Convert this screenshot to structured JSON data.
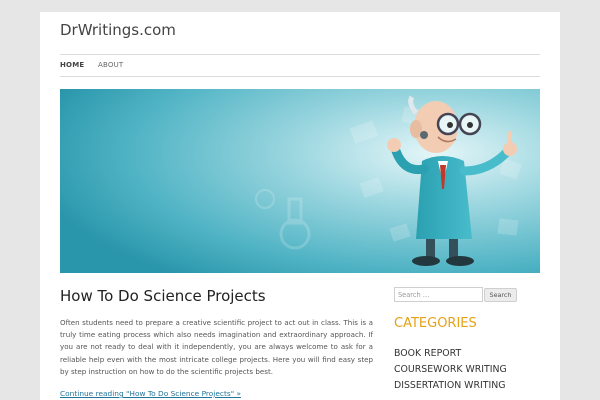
{
  "site": {
    "title": "DrWritings.com"
  },
  "nav": {
    "items": [
      {
        "label": "HOME"
      },
      {
        "label": "ABOUT"
      }
    ]
  },
  "post": {
    "title": "How To Do Science Projects",
    "excerpt": "Often students need to prepare a creative scientific project to act out in class. This is a truly time eating process which also needs imagination and extraordinary approach. If you are not ready to deal with it independently, you are always welcome to ask for a reliable help even with the most intricate college projects. Here you will find easy step by step instruction on how to do the scientific projects best.",
    "continue_label": "Continue reading \"How To Do Science Projects\" »"
  },
  "sidebar": {
    "search": {
      "placeholder": "Search …",
      "button_label": "Search"
    },
    "categories": {
      "heading": "CATEGORIES",
      "items": [
        {
          "label": "BOOK REPORT"
        },
        {
          "label": "COURSEWORK WRITING"
        },
        {
          "label": "DISSERTATION WRITING"
        }
      ]
    }
  },
  "colors": {
    "hero_bg": "#3ba6b9",
    "link": "#21759b",
    "category_heading": "#e6a117",
    "page_bg": "#e6e6e6"
  }
}
